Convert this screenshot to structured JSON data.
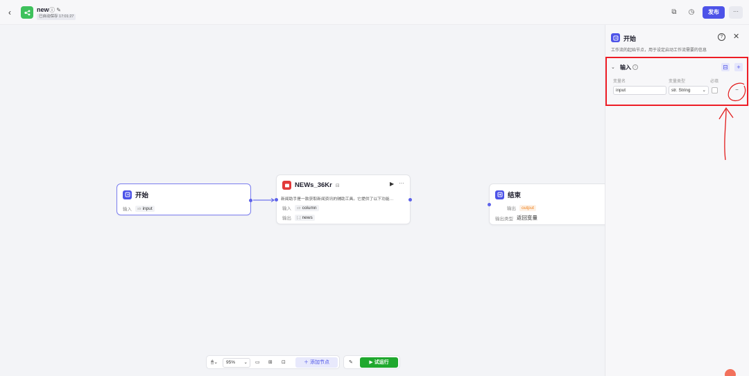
{
  "app": {
    "title": "new",
    "autosave": "已自动保存 17:01:27",
    "publish_label": "发布",
    "more_label": "···"
  },
  "nodes": {
    "start": {
      "title": "开始",
      "input_label": "输入",
      "input_type": "str",
      "input_name": "input"
    },
    "news": {
      "title": "NEWs_36Kr",
      "description": "新闻助手是一款获取新闻资讯的辅助工具。它提供了以下功能…",
      "input_label": "输入",
      "input_type": "str",
      "input_name": "column",
      "output_label": "输出",
      "output_type": "[..]",
      "output_name": "news"
    },
    "end": {
      "title": "结束",
      "output_label": "输出",
      "output_name": "output",
      "output_type_label": "输出类型",
      "output_type_value": "返回变量"
    }
  },
  "toolbar": {
    "zoom": "95%",
    "add_node_label": "添加节点",
    "run_label": "试运行"
  },
  "panel": {
    "title": "开始",
    "description": "工作流的起始节点，用于设定启动工作流需要的信息",
    "input_section": {
      "title": "输入",
      "col_name": "变量名",
      "col_type": "变量类型",
      "col_required": "必填",
      "row": {
        "name": "input",
        "type": "str. String"
      }
    }
  },
  "colors": {
    "accent": "#4d53e8",
    "run_green": "#1fa82e",
    "highlight_red": "#ee1c25"
  }
}
